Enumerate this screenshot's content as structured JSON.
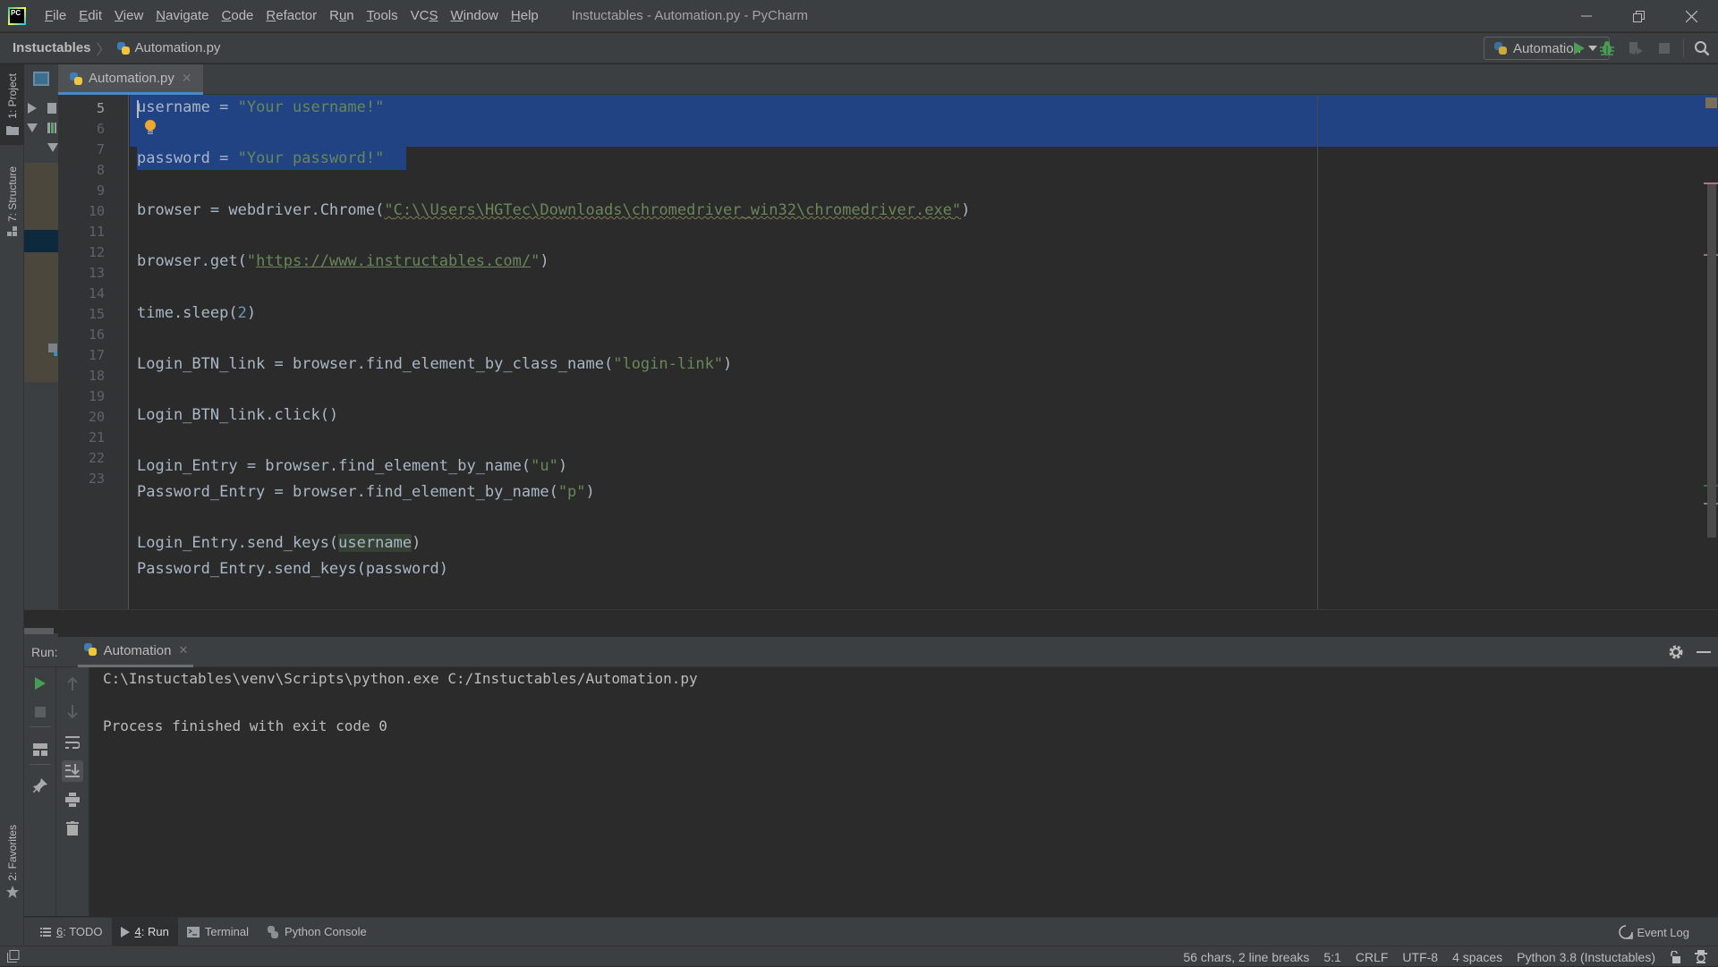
{
  "titlebar": {
    "logo_text": "PC",
    "menu": [
      {
        "label": "File",
        "mnemonic": "F"
      },
      {
        "label": "Edit",
        "mnemonic": "E"
      },
      {
        "label": "View",
        "mnemonic": "V"
      },
      {
        "label": "Navigate",
        "mnemonic": "N"
      },
      {
        "label": "Code",
        "mnemonic": "C"
      },
      {
        "label": "Refactor",
        "mnemonic": "R"
      },
      {
        "label": "Run",
        "mnemonic": "u"
      },
      {
        "label": "Tools",
        "mnemonic": "T"
      },
      {
        "label": "VCS",
        "mnemonic": "S"
      },
      {
        "label": "Window",
        "mnemonic": "W"
      },
      {
        "label": "Help",
        "mnemonic": "H"
      }
    ],
    "window_title": "Instuctables - Automation.py - PyCharm"
  },
  "navbar": {
    "project": "Instuctables",
    "file": "Automation.py",
    "run_config": "Automation"
  },
  "left_strip": {
    "project_tab": "1: Project",
    "structure_tab": "7: Structure",
    "favorites_tab": "2: Favorites"
  },
  "editor": {
    "tab_label": "Automation.py",
    "line_numbers": [
      "5",
      "6",
      "7",
      "8",
      "9",
      "10",
      "11",
      "12",
      "13",
      "14",
      "15",
      "16",
      "17",
      "18",
      "19",
      "20",
      "21",
      "22",
      "23"
    ],
    "lines": {
      "l5": {
        "a": "username = ",
        "b": "\"Your username!\""
      },
      "l7": {
        "a": "password = ",
        "b": "\"Your password!\""
      },
      "l9": {
        "a": "browser = webdriver.Chrome(",
        "q1": "\"",
        "path": "C:\\\\Users\\HGTec\\Downloads\\chromedriver_win32\\chromedriver.exe",
        "q2": "\"",
        "c": ")"
      },
      "l11": {
        "a": "browser.get(",
        "q1": "\"",
        "url": "https://www.instructables.com/",
        "q2": "\"",
        "c": ")"
      },
      "l13": {
        "a": "time.sleep(",
        "n": "2",
        "c": ")"
      },
      "l15": {
        "a": "Login_BTN_link = browser.find_element_by_class_name(",
        "s": "\"login-link\"",
        "c": ")"
      },
      "l17": {
        "a": "Login_BTN_link.click()"
      },
      "l19": {
        "a": "Login_Entry = browser.find_element_by_name(",
        "s": "\"u\"",
        "c": ")"
      },
      "l20": {
        "a": "Password_Entry = browser.find_element_by_name(",
        "s": "\"p\"",
        "c": ")"
      },
      "l22": {
        "a": "Login_Entry.send_keys(",
        "v": "username",
        "c": ")"
      },
      "l23": {
        "a": "Password_Entry.send_keys(password)"
      }
    }
  },
  "run_panel": {
    "label": "Run:",
    "tab_label": "Automation",
    "console": [
      "C:\\Instuctables\\venv\\Scripts\\python.exe C:/Instuctables/Automation.py",
      "",
      "Process finished with exit code 0"
    ]
  },
  "tool_tabs": {
    "todo": {
      "num": "6",
      "rest": ": TODO"
    },
    "run": {
      "num": "4",
      "rest": ": Run"
    },
    "terminal": "Terminal",
    "python_console": "Python Console",
    "event_log": "Event Log"
  },
  "statusbar": {
    "selection": "56 chars, 2 line breaks",
    "position": "5:1",
    "line_sep": "CRLF",
    "encoding": "UTF-8",
    "indent": "4 spaces",
    "interpreter": "Python 3.8 (Instuctables)"
  },
  "colors": {
    "selection": "#214283",
    "string": "#6a8759",
    "number": "#6897bb",
    "run_green": "#499c54",
    "accent_tab": "#4a88c7"
  }
}
